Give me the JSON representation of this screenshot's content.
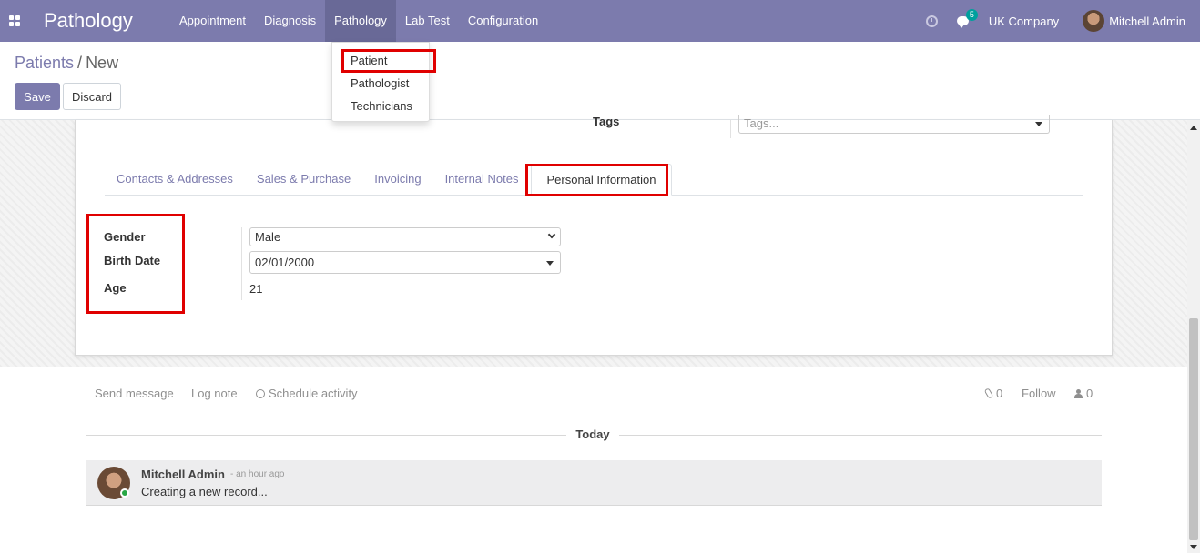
{
  "navbar": {
    "brand": "Pathology",
    "menu": [
      "Appointment",
      "Diagnosis",
      "Pathology",
      "Lab Test",
      "Configuration"
    ],
    "active_menu": "Pathology",
    "chat_count": "5",
    "company": "UK Company",
    "user": "Mitchell Admin",
    "colors": {
      "bar": "#7c7bad",
      "active": "#696997"
    }
  },
  "dropdown": {
    "items": [
      "Patient",
      "Pathologist",
      "Technicians"
    ]
  },
  "control_panel": {
    "breadcrumb_parent": "Patients",
    "breadcrumb_sep": "/",
    "breadcrumb_current": "New",
    "save_label": "Save",
    "discard_label": "Discard"
  },
  "form": {
    "tags_label": "Tags",
    "tags_placeholder": "Tags...",
    "tabs": [
      "Contacts & Addresses",
      "Sales & Purchase",
      "Invoicing",
      "Internal Notes",
      "Personal Information"
    ],
    "active_tab": "Personal Information",
    "fields": {
      "gender_label": "Gender",
      "gender_value": "Male",
      "birth_date_label": "Birth Date",
      "birth_date_value": "02/01/2000",
      "age_label": "Age",
      "age_value": "21"
    }
  },
  "chatter": {
    "send_message": "Send message",
    "log_note": "Log note",
    "schedule_activity": "Schedule activity",
    "attachments_count": "0",
    "follow": "Follow",
    "followers_count": "0",
    "today": "Today",
    "message": {
      "author": "Mitchell Admin",
      "time": "- an hour ago",
      "body": "Creating a new record..."
    }
  },
  "highlight_color": "#e00000"
}
